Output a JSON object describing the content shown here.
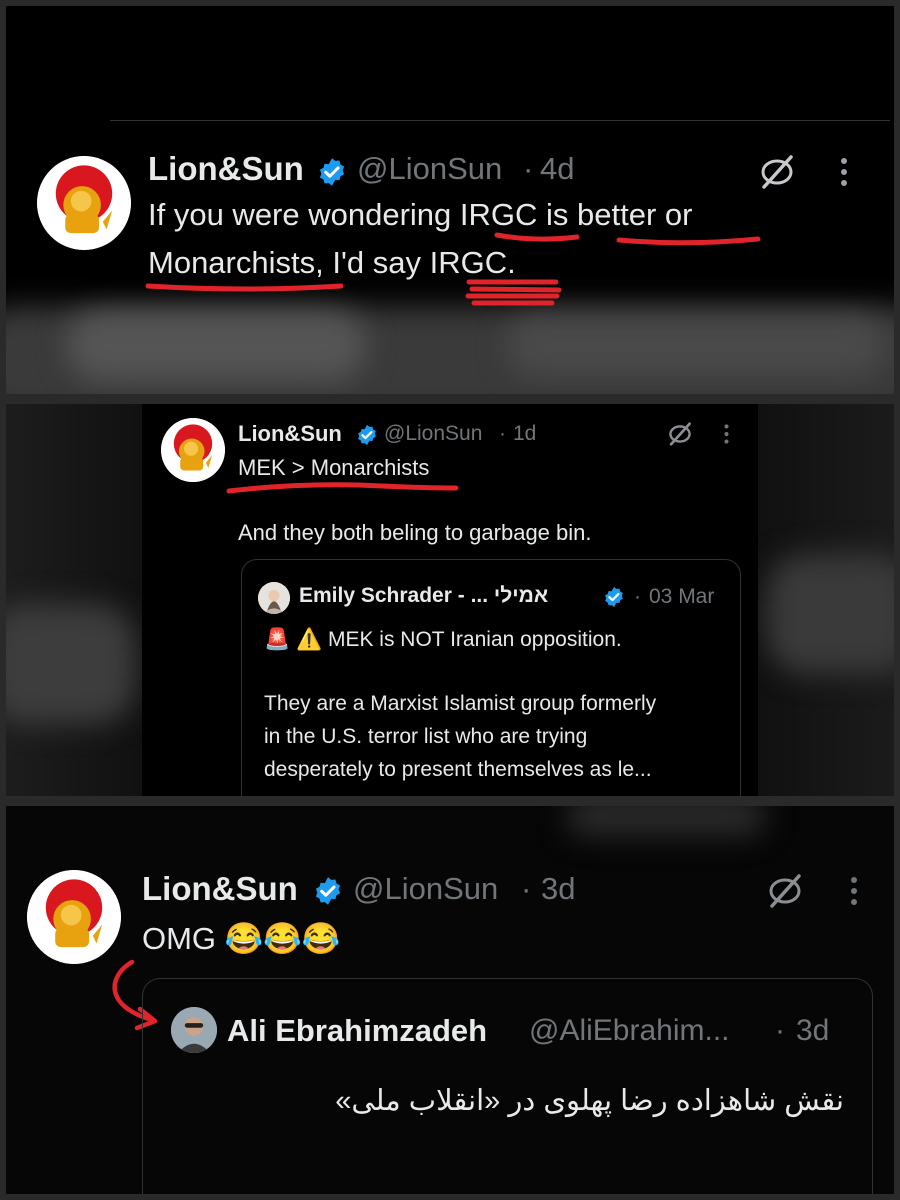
{
  "tweet1": {
    "name": "Lion&Sun",
    "handle": "@LionSun",
    "sep": "·",
    "time": "4d",
    "line1_a": "If you were wondering ",
    "line1_b": "IRGC",
    "line1_c": " is ",
    "line1_d": "better or",
    "line2_a": "Monarchists",
    "line2_b": ", I'd say ",
    "line2_c": "IRGC."
  },
  "tweet2": {
    "name": "Lion&Sun",
    "handle": "@LionSun",
    "sep": "·",
    "time": "1d",
    "line1": "MEK > Monarchists",
    "line2": "And they both beling to garbage bin.",
    "quote": {
      "name": "Emily Schrader - ... אמילי",
      "sep": "·",
      "time": "03 Mar",
      "line1": "🚨 ⚠️ MEK is NOT Iranian opposition.",
      "body": [
        "They are a Marxist Islamist group formerly",
        "in the U.S. terror list who are trying",
        "desperately to present themselves as le..."
      ]
    }
  },
  "tweet3": {
    "name": "Lion&Sun",
    "handle": "@LionSun",
    "sep": "·",
    "time": "3d",
    "text": "OMG 😂😂😂",
    "quote": {
      "name": "Ali Ebrahimzadeh",
      "handle": "@AliEbrahim...",
      "sep": "·",
      "time": "3d",
      "text": "نقش شاهزاده رضا پهلوی در «انقلاب ملی»"
    }
  },
  "colors": {
    "verified": "#1d9bf0",
    "annotation": "#e0242a",
    "muted": "#71767b"
  }
}
